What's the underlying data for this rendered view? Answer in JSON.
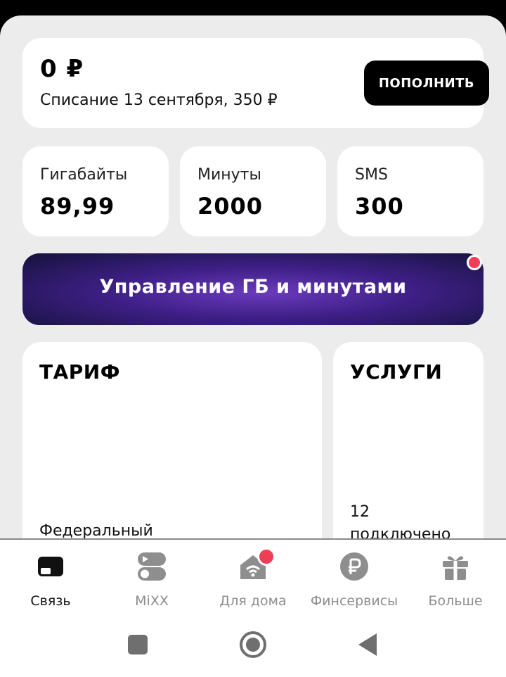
{
  "balance": {
    "amount": "0 ₽",
    "charge_note": "Списание 13 сентября, 350 ₽",
    "topup_label": "пополнить"
  },
  "stats": [
    {
      "label": "Гигабайты",
      "value": "89,99"
    },
    {
      "label": "Минуты",
      "value": "2000"
    },
    {
      "label": "SMS",
      "value": "300"
    }
  ],
  "manage_banner": {
    "label": "Управление ГБ и минутами"
  },
  "tariff": {
    "title": "ТАРИФ",
    "name": "Федеральный"
  },
  "services": {
    "title": "УСЛУГИ",
    "count": "12",
    "status": "подключено"
  },
  "bottom_nav": [
    {
      "label": "Связь",
      "icon": "sim-card-icon",
      "active": true
    },
    {
      "label": "MiXX",
      "icon": "mixx-toggle-icon"
    },
    {
      "label": "Для дома",
      "icon": "home-wifi-icon",
      "badge": true
    },
    {
      "label": "Финсервисы",
      "icon": "ruble-coin-icon"
    },
    {
      "label": "Больше",
      "icon": "gift-icon"
    }
  ],
  "system_nav": [
    "recents-square-icon",
    "home-circle-icon",
    "back-triangle-icon"
  ],
  "colors": {
    "accent_red": "#ef3e56",
    "banner_purple": "#5a2fa8",
    "black": "#000000"
  }
}
